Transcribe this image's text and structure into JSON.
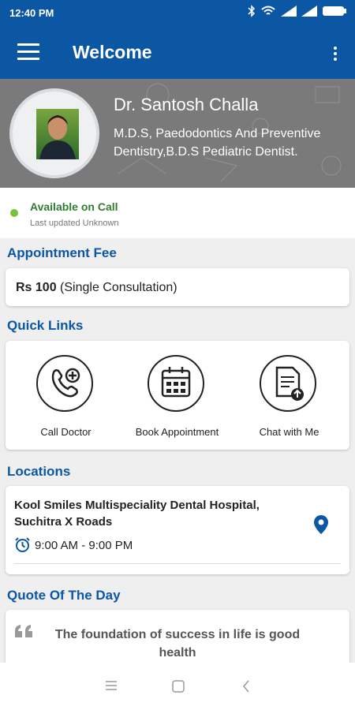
{
  "status_bar": {
    "time": "12:40 PM"
  },
  "app_bar": {
    "title": "Welcome"
  },
  "profile": {
    "name": "Dr. Santosh Challa",
    "qualifications": "M.D.S, Paedodontics And Preventive Dentistry,B.D.S Pediatric Dentist."
  },
  "availability": {
    "status": "Available on Call",
    "updated": "Last updated Unknown"
  },
  "fee": {
    "section_title": "Appointment Fee",
    "amount": "Rs 100",
    "note": "(Single Consultation)"
  },
  "quick_links": {
    "section_title": "Quick Links",
    "items": [
      {
        "label": "Call Doctor",
        "icon": "phone-plus-icon"
      },
      {
        "label": "Book Appointment",
        "icon": "calendar-icon"
      },
      {
        "label": "Chat with Me",
        "icon": "document-upload-icon"
      }
    ]
  },
  "locations": {
    "section_title": "Locations",
    "items": [
      {
        "name": "Kool Smiles Multispeciality Dental Hospital, Suchitra X Roads",
        "hours": "9:00 AM - 9:00 PM"
      }
    ]
  },
  "quote": {
    "section_title": "Quote Of The Day",
    "text": "The foundation of success in life is good health"
  },
  "colors": {
    "primary": "#0b57a4",
    "available": "#78c33b"
  }
}
